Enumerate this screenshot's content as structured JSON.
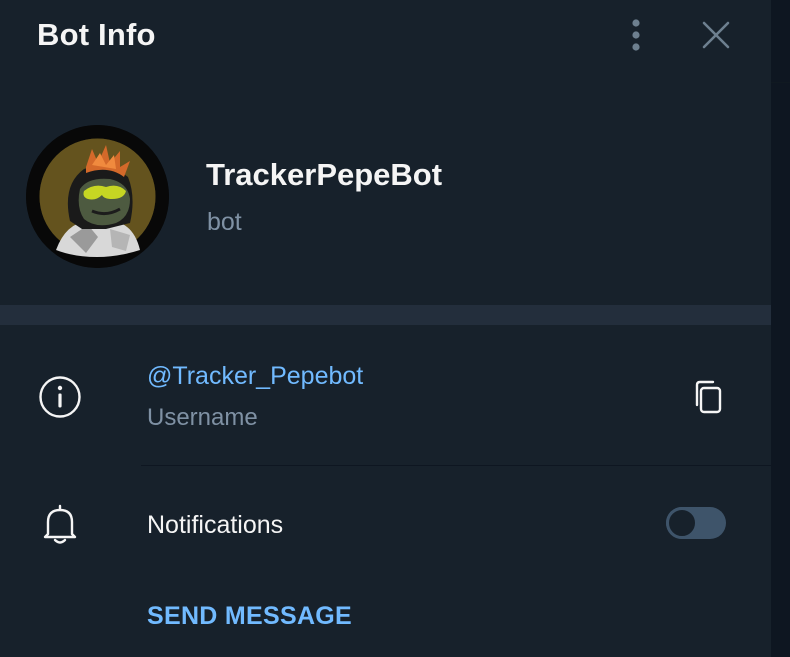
{
  "header": {
    "title": "Bot Info",
    "more_icon": "vertical-dots-icon",
    "close_icon": "close-icon"
  },
  "profile": {
    "name": "TrackerPepeBot",
    "subtitle": "bot",
    "avatar": "pepe-avatar-image"
  },
  "info": {
    "username": "@Tracker_Pepebot",
    "username_label": "Username",
    "icon": "info-icon",
    "copy_icon": "copy-icon"
  },
  "notifications": {
    "label": "Notifications",
    "icon": "bell-icon",
    "enabled": false
  },
  "actions": {
    "send_message": "SEND MESSAGE"
  },
  "colors": {
    "background": "#17212b",
    "separator": "#232e3c",
    "accent": "#71baff",
    "secondary_text": "#7f91a4",
    "primary_text": "#f5f5f5",
    "toggle_off": "#3e546a"
  }
}
